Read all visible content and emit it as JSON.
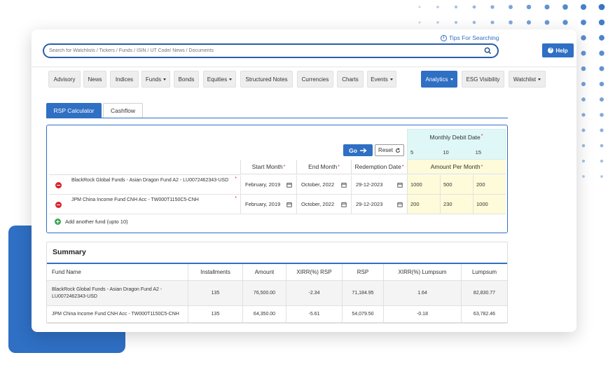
{
  "header": {
    "tips_label": "Tips For Searching",
    "search_placeholder": "Search for Watchlists / Tickers / Funds / ISIN / UT Code/ News / Documents",
    "help_label": "Help"
  },
  "nav": [
    {
      "label": "Advisory"
    },
    {
      "label": "News"
    },
    {
      "label": "Indices"
    },
    {
      "label": "Funds"
    },
    {
      "label": "Bonds"
    },
    {
      "label": "Equities"
    },
    {
      "label": "Structured Notes"
    },
    {
      "label": "Currencies"
    },
    {
      "label": "Charts"
    },
    {
      "label": "Events"
    },
    {
      "label": "Analytics"
    },
    {
      "label": "ESG Visibility"
    },
    {
      "label": "Watchlist"
    }
  ],
  "tabs": {
    "rsp": "RSP Calculator",
    "cashflow": "Cashflow"
  },
  "calculator": {
    "monthly_debit_label": "Monthly Debit Date",
    "debit_dates": [
      "5",
      "10",
      "15"
    ],
    "go_label": "Go",
    "reset_label": "Reset",
    "columns": {
      "start": "Start Month",
      "end": "End Month",
      "redemption": "Redemption Date",
      "amount": "Amount Per Month"
    },
    "rows": [
      {
        "fund": "BlackRock Global Funds - Asian Dragon Fund A2 - LU0072462343-USD",
        "start": "February, 2019",
        "end": "October, 2022",
        "redemption": "29-12-2023",
        "amounts": [
          "1000",
          "500",
          "200"
        ]
      },
      {
        "fund": "JPM China Income Fund CNH Acc - TW000T1150C5-CNH",
        "start": "February, 2019",
        "end": "October, 2022",
        "redemption": "29-12-2023",
        "amounts": [
          "200",
          "230",
          "1000"
        ]
      }
    ],
    "add_fund_label": "Add another fund (upto 10)",
    "required_mark": "*"
  },
  "summary": {
    "title": "Summary",
    "headers": [
      "Fund Name",
      "Installments",
      "Amount",
      "XIRR(%) RSP",
      "RSP",
      "XIRR(%) Lumpsum",
      "Lumpsum"
    ],
    "rows": [
      {
        "fund_line1": "BlackRock Global Funds - Asian Dragon Fund A2 -",
        "fund_line2": "LU0072462343-USD",
        "installments": "135",
        "amount": "76,500.00",
        "xirr_rsp": "-2.34",
        "rsp": "71,184.95",
        "xirr_lumpsum": "1.64",
        "lumpsum": "82,830.77"
      },
      {
        "fund_line1": "JPM China Income Fund CNH Acc - TW000T1150C5-CNH",
        "fund_line2": "",
        "installments": "135",
        "amount": "64,350.00",
        "xirr_rsp": "-5.61",
        "rsp": "54,079.50",
        "xirr_lumpsum": "-0.18",
        "lumpsum": "63,782.46"
      }
    ]
  },
  "colors": {
    "primary": "#2f6fc4",
    "teal_bg": "#e0f7f7",
    "yellow_bg": "#fdfbd9",
    "remove_red": "#d9252e",
    "add_green": "#3aa655"
  }
}
